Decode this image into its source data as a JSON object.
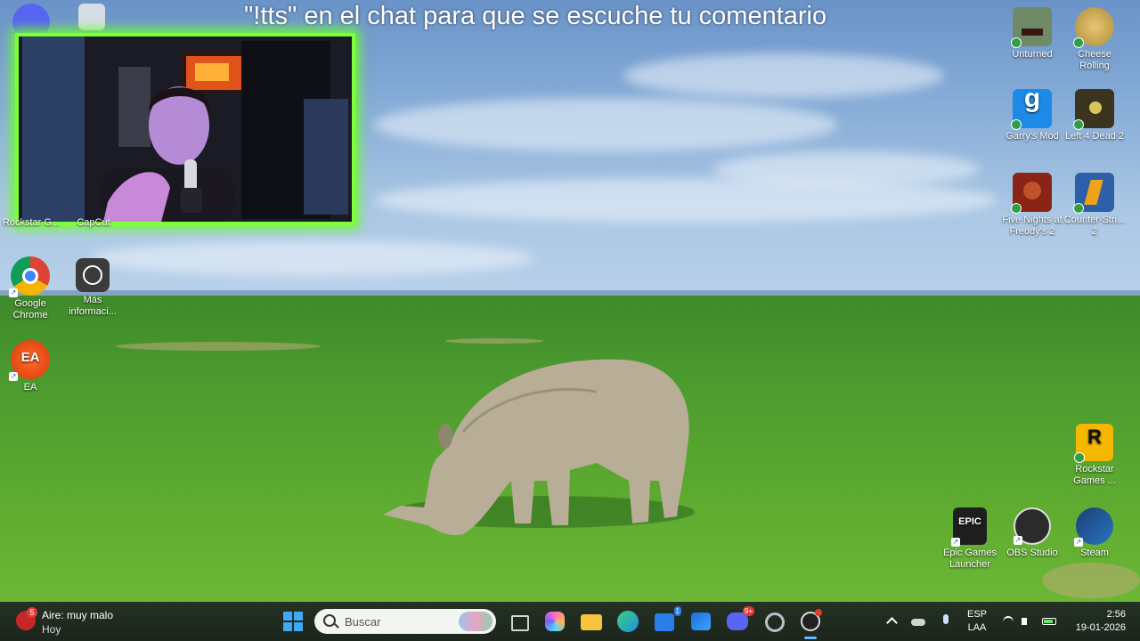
{
  "stream_overlay": {
    "text": "\"!tts\" en el chat para que se escuche tu comentario"
  },
  "webcam": {
    "label": "Webcam"
  },
  "desktop_icons_left": [
    {
      "label": "Google Chrome",
      "icon": "chrome-icon"
    },
    {
      "label": "Más informaci...",
      "icon": "more-info-icon"
    },
    {
      "label": "EA",
      "icon": "ea-icon"
    }
  ],
  "desktop_icons_left_partial": [
    "Rockstar G...",
    "CapCut"
  ],
  "desktop_icons_right": [
    {
      "label": "Unturned",
      "icon": "unturned-icon"
    },
    {
      "label": "Cheese Rolling",
      "icon": "cheese-rolling-icon"
    },
    {
      "label": "Garry's Mod",
      "icon": "garrys-mod-icon"
    },
    {
      "label": "Left 4 Dead 2",
      "icon": "left-4-dead-2-icon"
    },
    {
      "label": "Five Nights at Freddy's 2",
      "icon": "fnaf2-icon"
    },
    {
      "label": "Counter-Stri... 2",
      "icon": "counter-strike-2-icon"
    },
    {
      "label": "Rockstar Games ...",
      "icon": "rockstar-games-icon"
    },
    {
      "label": "Epic Games Launcher",
      "icon": "epic-games-icon"
    },
    {
      "label": "OBS Studio",
      "icon": "obs-studio-icon"
    },
    {
      "label": "Steam",
      "icon": "steam-icon"
    }
  ],
  "taskbar": {
    "weather_main": "Aire: muy malo",
    "weather_sub": "Hoy",
    "weather_badge": "5",
    "search_placeholder": "Buscar",
    "apps": [
      {
        "name": "task-view",
        "badge": ""
      },
      {
        "name": "copilot",
        "badge": ""
      },
      {
        "name": "file-explorer",
        "badge": ""
      },
      {
        "name": "edge",
        "badge": ""
      },
      {
        "name": "microsoft-store",
        "badge": "1"
      },
      {
        "name": "outlook",
        "badge": ""
      },
      {
        "name": "discord",
        "badge": "9+"
      },
      {
        "name": "settings",
        "badge": ""
      },
      {
        "name": "obs-studio",
        "badge": ""
      }
    ],
    "language_top": "ESP",
    "language_bottom": "LAA",
    "time": "2:56",
    "date": "19-01-2026"
  },
  "colors": {
    "webcam_border": "#7dff3a",
    "taskbar_bg": "#1f2a1f",
    "sky": "#86acd7",
    "grass": "#4d9c2f"
  }
}
